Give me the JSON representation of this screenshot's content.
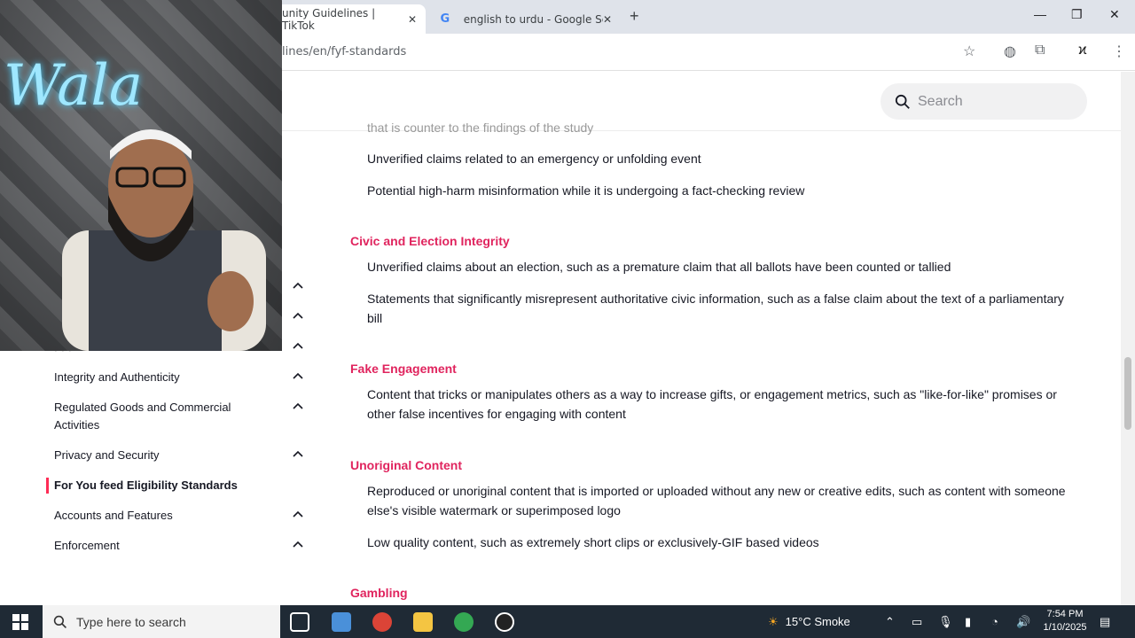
{
  "browser": {
    "active_tab": "unity Guidelines | TikTok",
    "inactive_tab": "english to urdu - Google Search",
    "url": "lines/en/fyf-standards"
  },
  "page": {
    "search_placeholder": "Search"
  },
  "sidebar": {
    "items": [
      {
        "label": "Integrity and Authenticity",
        "expandable": true
      },
      {
        "label": "Regulated Goods and Commercial Activities",
        "expandable": true
      },
      {
        "label": "Privacy and Security",
        "expandable": true
      },
      {
        "label": "For You feed Eligibility Standards",
        "expandable": false,
        "active": true
      },
      {
        "label": "Accounts and Features",
        "expandable": true
      },
      {
        "label": "Enforcement",
        "expandable": true
      }
    ]
  },
  "content": {
    "cut_line": "that is counter to the findings of the study",
    "intro_items": [
      "Unverified claims related to an emergency or unfolding event",
      "Potential high-harm misinformation while it is undergoing a fact-checking review"
    ],
    "sections": [
      {
        "heading": "Civic and Election Integrity",
        "items": [
          "Unverified claims about an election, such as a premature claim that all ballots have been counted or tallied",
          "Statements that significantly misrepresent authoritative civic information, such as a false claim about the text of a parliamentary bill"
        ]
      },
      {
        "heading": "Fake Engagement",
        "items": [
          "Content that tricks or manipulates others as a way to increase gifts, or engagement metrics, such as \"like-for-like\" promises or other false incentives for engaging with content"
        ]
      },
      {
        "heading": "Unoriginal Content",
        "items": [
          "Reproduced or unoriginal content that is imported or uploaded without any new or creative edits, such as content with someone else's visible watermark or superimposed logo",
          "Low quality content, such as extremely short clips or exclusively-GIF based videos"
        ]
      },
      {
        "heading": "Gambling",
        "items": []
      }
    ]
  },
  "taskbar": {
    "search_placeholder": "Type here to search",
    "weather": "15°C  Smoke",
    "time": "7:54 PM",
    "date": "1/10/2025"
  },
  "colors": {
    "accent_pink": "#e0245e",
    "active_bar": "#fe2c55",
    "taskbar": "#1f2a35"
  }
}
